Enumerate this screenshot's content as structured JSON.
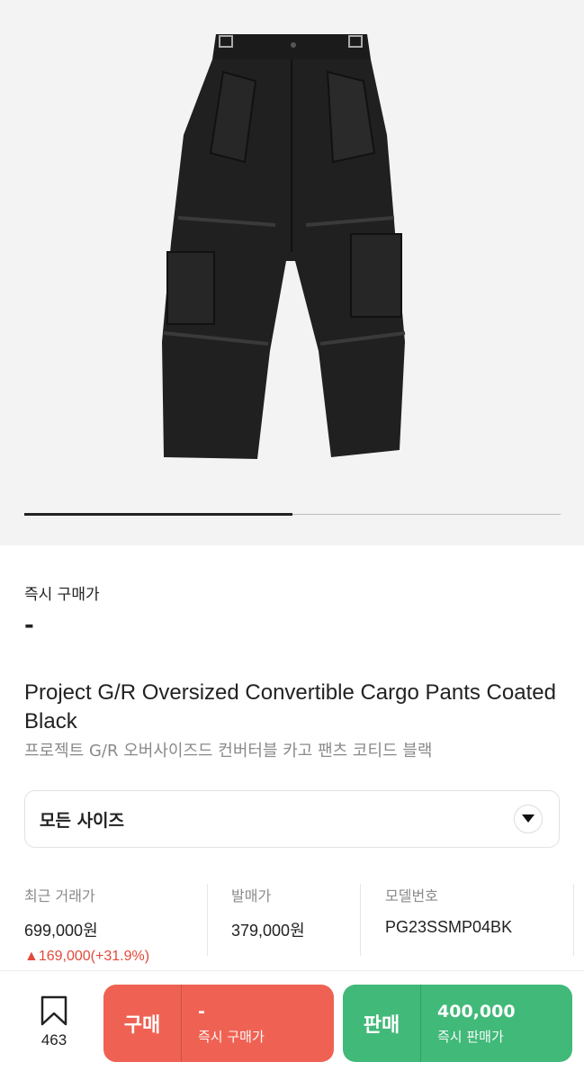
{
  "gallery": {
    "progress": 0.5
  },
  "instant_buy": {
    "label": "즉시 구매가",
    "value": "-"
  },
  "product": {
    "title_en": "Project G/R Oversized Convertible Cargo Pants Coated Black",
    "title_ko": "프로젝트 G/R 오버사이즈드 컨버터블 카고 팬츠 코티드 블랙"
  },
  "size_select": {
    "label": "모든 사이즈",
    "icon": "chevron-down-icon"
  },
  "info": {
    "recent_trade": {
      "label": "최근 거래가",
      "value": "699,000원",
      "change": "▲169,000(+31.9%)"
    },
    "release_price": {
      "label": "발매가",
      "value": "379,000원"
    },
    "model_number": {
      "label": "모델번호",
      "value": "PG23SSMP04BK"
    }
  },
  "footer": {
    "wishlist_count": "463",
    "buy": {
      "label": "구매",
      "price": "-",
      "sub": "즉시 구매가",
      "color": "#ef6253"
    },
    "sell": {
      "label": "판매",
      "price": "400,000",
      "sub": "즉시 판매가",
      "color": "#41b979"
    }
  }
}
